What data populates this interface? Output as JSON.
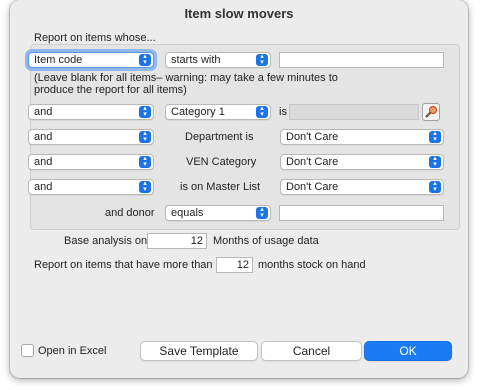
{
  "window": {
    "title": "Item slow movers"
  },
  "report": {
    "section_label": "Report on items whose...",
    "field_select": "Item code",
    "operator_select": "starts with",
    "value": "",
    "note": "(Leave blank for all items– warning: may take a few minutes to produce the report for all items)"
  },
  "rows": {
    "category": {
      "conj": "and",
      "select": "Category 1",
      "label": "is"
    },
    "department": {
      "conj": "and",
      "label": "Department is",
      "value": "Don't Care"
    },
    "ven": {
      "conj": "and",
      "label": "VEN Category",
      "value": "Don't Care"
    },
    "master": {
      "conj": "and",
      "label": "is on Master List",
      "value": "Don't Care"
    },
    "donor": {
      "label": "and donor",
      "operator": "equals",
      "value": ""
    }
  },
  "analysis": {
    "base_label": "Base analysis on",
    "months": "12",
    "months_suffix": "Months of usage data",
    "stock_label": "Report on items that have more than",
    "stock_months": "12",
    "stock_suffix": "months stock on hand"
  },
  "footer": {
    "open_excel": "Open in Excel",
    "save_template": "Save Template",
    "cancel": "Cancel",
    "ok": "OK"
  },
  "colors": {
    "accent": "#1a7bf2",
    "focus_ring": "#8fb8ef"
  }
}
